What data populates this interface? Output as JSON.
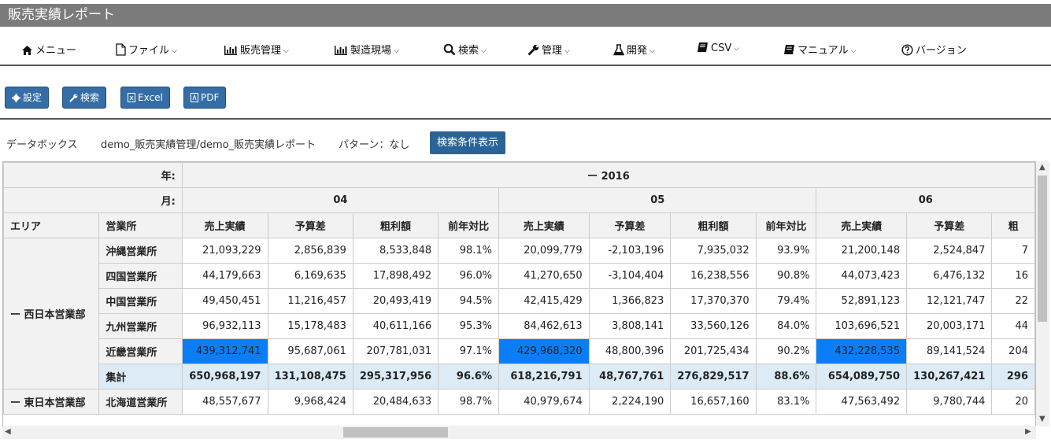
{
  "app": {
    "title": "販売実績レポート"
  },
  "menu": [
    {
      "label": "メニュー",
      "icon": "home-icon",
      "chevron": false
    },
    {
      "label": "ファイル",
      "icon": "file-icon",
      "chevron": true
    },
    {
      "label": "販売管理",
      "icon": "bar-chart-icon",
      "chevron": true
    },
    {
      "label": "製造現場",
      "icon": "bar-chart-icon",
      "chevron": true
    },
    {
      "label": "検索",
      "icon": "search-icon",
      "chevron": true
    },
    {
      "label": "管理",
      "icon": "wrench-icon",
      "chevron": true
    },
    {
      "label": "開発",
      "icon": "flask-icon",
      "chevron": true
    },
    {
      "label": "CSV",
      "icon": "book-icon",
      "chevron": true
    },
    {
      "label": "マニュアル",
      "icon": "book-icon",
      "chevron": true
    },
    {
      "label": "バージョン",
      "icon": "question-circle-icon",
      "chevron": false
    }
  ],
  "toolbar": {
    "settings": "設定",
    "search": "検索",
    "excel": "Excel",
    "pdf": "PDF"
  },
  "info": {
    "databox_label": "データボックス",
    "path": "demo_販売実績管理/demo_販売実績レポート",
    "pattern": "パターン：なし",
    "show_conditions": "検索条件表示"
  },
  "grid": {
    "year_label": "年:",
    "month_label": "月:",
    "year": "ー 2016",
    "months": [
      "04",
      "05",
      "06"
    ],
    "area_header": "エリア",
    "office_header": "営業所",
    "metrics": [
      "売上実績",
      "予算差",
      "粗利額",
      "前年対比"
    ],
    "metric_partial": "粗",
    "areas": [
      {
        "name": "ー 西日本営業部",
        "rows": [
          {
            "office": "沖縄営業所",
            "values": [
              "21,093,229",
              "2,856,839",
              "8,533,848",
              "98.1%",
              "20,099,779",
              "-2,103,196",
              "7,935,032",
              "93.9%",
              "21,200,148",
              "2,524,847",
              "7"
            ]
          },
          {
            "office": "四国営業所",
            "values": [
              "44,179,663",
              "6,169,635",
              "17,898,492",
              "96.0%",
              "41,270,650",
              "-3,104,404",
              "16,238,556",
              "90.8%",
              "44,073,423",
              "6,476,132",
              "16"
            ]
          },
          {
            "office": "中国営業所",
            "values": [
              "49,450,451",
              "11,216,457",
              "20,493,419",
              "94.5%",
              "42,415,429",
              "1,366,823",
              "17,370,370",
              "79.4%",
              "52,891,123",
              "12,121,747",
              "22"
            ]
          },
          {
            "office": "九州営業所",
            "values": [
              "96,932,113",
              "15,178,483",
              "40,611,166",
              "95.3%",
              "84,462,613",
              "3,808,141",
              "33,560,126",
              "84.0%",
              "103,696,521",
              "20,003,171",
              "44"
            ]
          },
          {
            "office": "近畿営業所",
            "values": [
              "439,312,741",
              "95,687,061",
              "207,781,031",
              "97.1%",
              "429,968,320",
              "48,800,396",
              "201,725,434",
              "90.2%",
              "432,228,535",
              "89,141,524",
              "204"
            ],
            "highlight": true
          },
          {
            "office": "集計",
            "values": [
              "650,968,197",
              "131,108,475",
              "295,317,956",
              "96.6%",
              "618,216,791",
              "48,767,761",
              "276,829,517",
              "88.6%",
              "654,089,750",
              "130,267,421",
              "296"
            ],
            "total": true
          }
        ]
      },
      {
        "name": "ー 東日本営業部",
        "rows": [
          {
            "office": "北海道営業所",
            "values": [
              "48,557,677",
              "9,968,424",
              "20,484,633",
              "98.7%",
              "40,979,674",
              "2,224,190",
              "16,657,160",
              "83.1%",
              "47,563,492",
              "9,780,744",
              "20"
            ]
          }
        ]
      }
    ]
  },
  "colors": {
    "titlebar": "#7b7b7b",
    "button": "#356ea6",
    "highlight": "#0a7ef6",
    "total_row": "#dcebf5"
  }
}
